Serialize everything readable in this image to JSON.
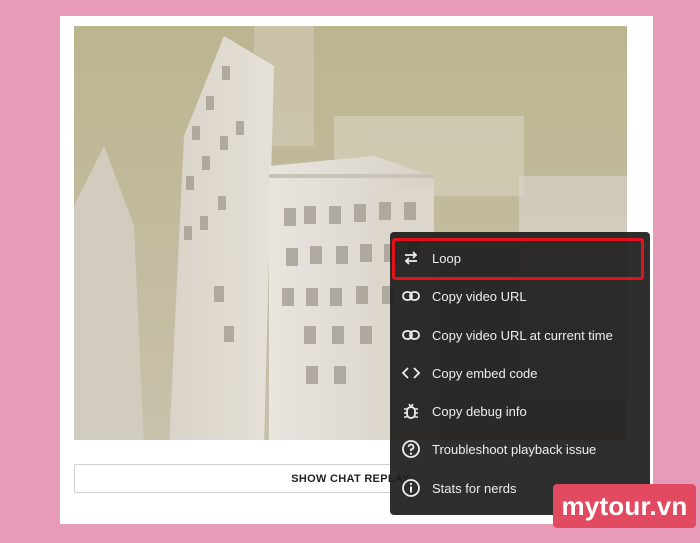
{
  "chat_replay": {
    "label": "SHOW CHAT REPLAY"
  },
  "context_menu": {
    "items": [
      {
        "label": "Loop",
        "icon": "loop-icon"
      },
      {
        "label": "Copy video URL",
        "icon": "link-icon"
      },
      {
        "label": "Copy video URL at current time",
        "icon": "link-icon"
      },
      {
        "label": "Copy embed code",
        "icon": "code-icon"
      },
      {
        "label": "Copy debug info",
        "icon": "bug-icon"
      },
      {
        "label": "Troubleshoot playback issue",
        "icon": "help-icon"
      },
      {
        "label": "Stats for nerds",
        "icon": "info-icon"
      }
    ]
  },
  "watermark": {
    "text": "mytour.vn"
  },
  "colors": {
    "highlight": "#e0121a",
    "menu_bg": "#1c1c1c",
    "brand": "#e24a62",
    "page_bg": "#e89bb8"
  }
}
